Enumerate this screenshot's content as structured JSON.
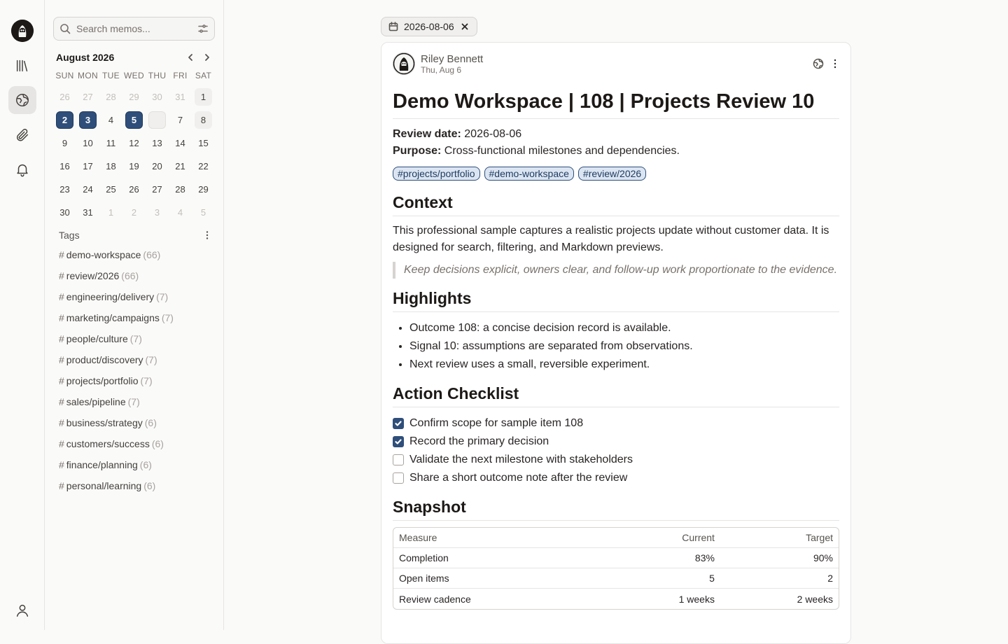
{
  "rail": {
    "items": [
      "library",
      "explore",
      "attachments",
      "notifications"
    ],
    "user": "profile"
  },
  "search": {
    "placeholder": "Search memos..."
  },
  "calendar": {
    "month_label": "August 2026",
    "weekdays": [
      "SUN",
      "MON",
      "TUE",
      "WED",
      "THU",
      "FRI",
      "SAT"
    ],
    "weeks": [
      [
        {
          "d": "26",
          "s": "muted"
        },
        {
          "d": "27",
          "s": "muted"
        },
        {
          "d": "28",
          "s": "muted"
        },
        {
          "d": "29",
          "s": "muted"
        },
        {
          "d": "30",
          "s": "muted"
        },
        {
          "d": "31",
          "s": "muted"
        },
        {
          "d": "1",
          "s": "shade"
        }
      ],
      [
        {
          "d": "2",
          "s": "sel"
        },
        {
          "d": "3",
          "s": "sel"
        },
        {
          "d": "4",
          "s": ""
        },
        {
          "d": "5",
          "s": "sel"
        },
        {
          "d": "",
          "s": "today"
        },
        {
          "d": "7",
          "s": ""
        },
        {
          "d": "8",
          "s": "shade"
        }
      ],
      [
        {
          "d": "9",
          "s": ""
        },
        {
          "d": "10",
          "s": ""
        },
        {
          "d": "11",
          "s": ""
        },
        {
          "d": "12",
          "s": ""
        },
        {
          "d": "13",
          "s": ""
        },
        {
          "d": "14",
          "s": ""
        },
        {
          "d": "15",
          "s": ""
        }
      ],
      [
        {
          "d": "16",
          "s": ""
        },
        {
          "d": "17",
          "s": ""
        },
        {
          "d": "18",
          "s": ""
        },
        {
          "d": "19",
          "s": ""
        },
        {
          "d": "20",
          "s": ""
        },
        {
          "d": "21",
          "s": ""
        },
        {
          "d": "22",
          "s": ""
        }
      ],
      [
        {
          "d": "23",
          "s": ""
        },
        {
          "d": "24",
          "s": ""
        },
        {
          "d": "25",
          "s": ""
        },
        {
          "d": "26",
          "s": ""
        },
        {
          "d": "27",
          "s": ""
        },
        {
          "d": "28",
          "s": ""
        },
        {
          "d": "29",
          "s": ""
        }
      ],
      [
        {
          "d": "30",
          "s": ""
        },
        {
          "d": "31",
          "s": ""
        },
        {
          "d": "1",
          "s": "muted"
        },
        {
          "d": "2",
          "s": "muted"
        },
        {
          "d": "3",
          "s": "muted"
        },
        {
          "d": "4",
          "s": "muted"
        },
        {
          "d": "5",
          "s": "muted"
        }
      ]
    ]
  },
  "tags": {
    "heading": "Tags",
    "items": [
      {
        "name": "demo-workspace",
        "count": "(66)"
      },
      {
        "name": "review/2026",
        "count": "(66)"
      },
      {
        "name": "engineering/delivery",
        "count": "(7)"
      },
      {
        "name": "marketing/campaigns",
        "count": "(7)"
      },
      {
        "name": "people/culture",
        "count": "(7)"
      },
      {
        "name": "product/discovery",
        "count": "(7)"
      },
      {
        "name": "projects/portfolio",
        "count": "(7)"
      },
      {
        "name": "sales/pipeline",
        "count": "(7)"
      },
      {
        "name": "business/strategy",
        "count": "(6)"
      },
      {
        "name": "customers/success",
        "count": "(6)"
      },
      {
        "name": "finance/planning",
        "count": "(6)"
      },
      {
        "name": "personal/learning",
        "count": "(6)"
      }
    ]
  },
  "filter_chip": {
    "label": "2026-08-06"
  },
  "memo": {
    "author": "Riley Bennett",
    "date": "Thu, Aug 6",
    "title": "Demo Workspace | 108 | Projects Review 10",
    "review_label": "Review date:",
    "review_value": "2026-08-06",
    "purpose_label": "Purpose:",
    "purpose_value": "Cross-functional milestones and dependencies.",
    "tags": [
      "#projects/portfolio",
      "#demo-workspace",
      "#review/2026"
    ],
    "context_heading": "Context",
    "context_text": "This professional sample captures a realistic projects update without customer data. It is designed for search, filtering, and Markdown previews.",
    "quote": "Keep decisions explicit, owners clear, and follow-up work proportionate to the evidence.",
    "highlights_heading": "Highlights",
    "highlights": [
      "Outcome 108: a concise decision record is available.",
      "Signal 10: assumptions are separated from observations.",
      "Next review uses a small, reversible experiment."
    ],
    "checklist_heading": "Action Checklist",
    "checklist": [
      {
        "text": "Confirm scope for sample item 108",
        "done": true
      },
      {
        "text": "Record the primary decision",
        "done": true
      },
      {
        "text": "Validate the next milestone with stakeholders",
        "done": false
      },
      {
        "text": "Share a short outcome note after the review",
        "done": false
      }
    ],
    "snapshot_heading": "Snapshot",
    "table": {
      "headers": [
        "Measure",
        "Current",
        "Target"
      ],
      "rows": [
        [
          "Completion",
          "83%",
          "90%"
        ],
        [
          "Open items",
          "5",
          "2"
        ],
        [
          "Review cadence",
          "1 weeks",
          "2 weeks"
        ]
      ]
    }
  },
  "colors": {
    "accent": "#2f4f7a",
    "border": "#e7e5e4"
  }
}
